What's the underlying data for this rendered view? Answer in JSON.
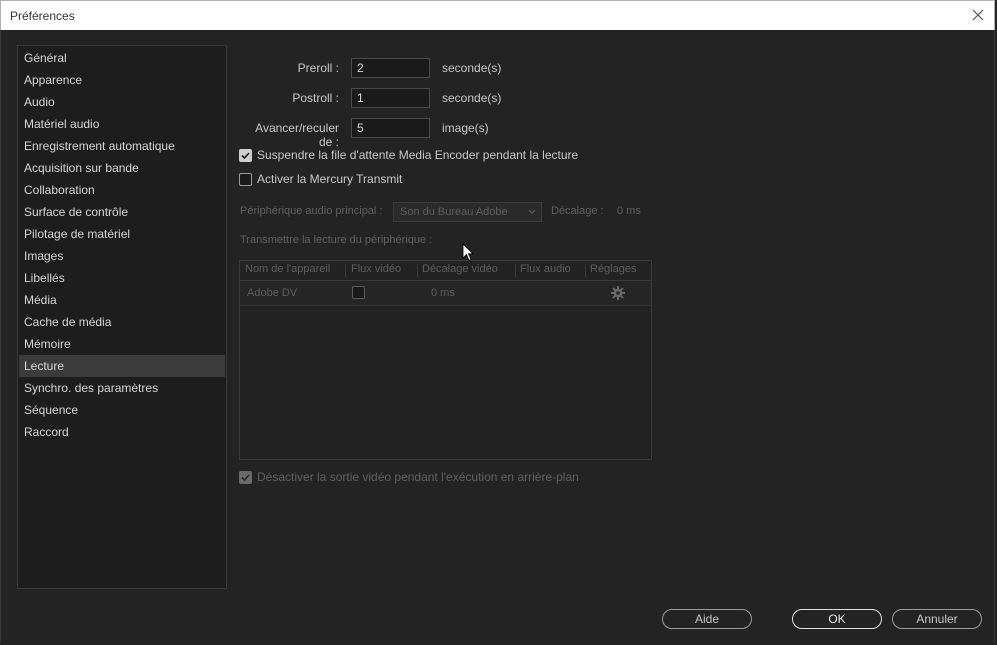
{
  "window": {
    "title": "Préférences"
  },
  "sidebar": {
    "items": [
      {
        "label": "Général",
        "selected": false
      },
      {
        "label": "Apparence",
        "selected": false
      },
      {
        "label": "Audio",
        "selected": false
      },
      {
        "label": "Matériel audio",
        "selected": false
      },
      {
        "label": "Enregistrement automatique",
        "selected": false
      },
      {
        "label": "Acquisition sur bande",
        "selected": false
      },
      {
        "label": "Collaboration",
        "selected": false
      },
      {
        "label": "Surface de contrôle",
        "selected": false
      },
      {
        "label": "Pilotage de matériel",
        "selected": false
      },
      {
        "label": "Images",
        "selected": false
      },
      {
        "label": "Libellés",
        "selected": false
      },
      {
        "label": "Média",
        "selected": false
      },
      {
        "label": "Cache de média",
        "selected": false
      },
      {
        "label": "Mémoire",
        "selected": false
      },
      {
        "label": "Lecture",
        "selected": true
      },
      {
        "label": "Synchro. des paramètres",
        "selected": false
      },
      {
        "label": "Séquence",
        "selected": false
      },
      {
        "label": "Raccord",
        "selected": false
      }
    ]
  },
  "playback": {
    "preroll": {
      "label": "Preroll :",
      "value": "2",
      "unit": "seconde(s)"
    },
    "postroll": {
      "label": "Postroll :",
      "value": "1",
      "unit": "seconde(s)"
    },
    "step": {
      "label": "Avancer/reculer de :",
      "value": "5",
      "unit": "image(s)"
    },
    "suspend_queue": {
      "label": "Suspendre la file d'attente Media Encoder pendant la lecture",
      "checked": true
    },
    "mercury": {
      "label": "Activer la Mercury Transmit",
      "checked": false
    },
    "audio_device": {
      "label": "Périphérique audio principal :",
      "value": "Son du Bureau Adobe"
    },
    "offset": {
      "label": "Décalage :",
      "value": "0 ms"
    },
    "transmit_label": "Transmettre la lecture du périphérique :",
    "table": {
      "headers": [
        "Nom de l'appareil",
        "Flux vidéo",
        "Décalage vidéo",
        "Flux audio",
        "Réglages"
      ],
      "rows": [
        {
          "name": "Adobe DV",
          "video": false,
          "offset": "0 ms"
        }
      ]
    },
    "disable_output": {
      "label": "Désactiver la sortie vidéo pendant l'exécution en arrière-plan",
      "checked": true
    }
  },
  "buttons": {
    "help": "Aide",
    "ok": "OK",
    "cancel": "Annuler"
  },
  "icons": {
    "close": "close-icon",
    "gear": "gear-icon",
    "check": "check-icon",
    "chevron": "chevron-down-icon"
  }
}
